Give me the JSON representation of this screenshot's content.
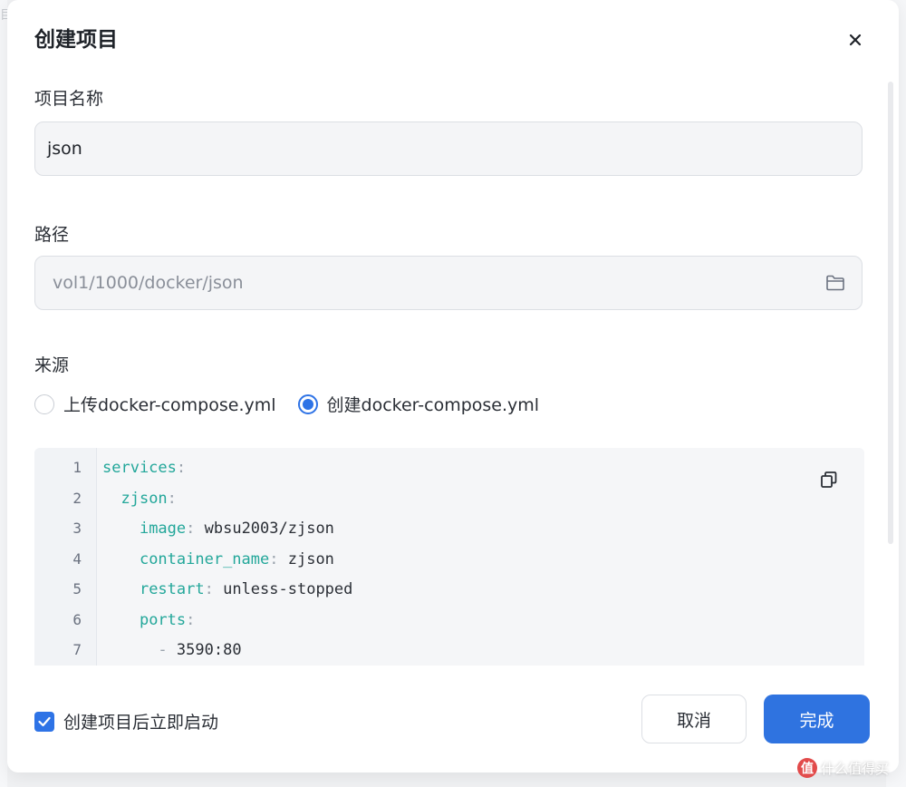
{
  "dialog": {
    "title": "创建项目",
    "close_label": "×"
  },
  "form": {
    "name_label": "项目名称",
    "name_value": "json",
    "path_label": "路径",
    "path_value": "vol1/1000/docker/json",
    "source_label": "来源",
    "source_options": [
      {
        "label": "上传docker-compose.yml",
        "selected": false
      },
      {
        "label": "创建docker-compose.yml",
        "selected": true
      }
    ]
  },
  "editor": {
    "lines": [
      {
        "num": "1",
        "indent": "",
        "key": "services",
        "sep": ":",
        "value": ""
      },
      {
        "num": "2",
        "indent": "  ",
        "key": "zjson",
        "sep": ":",
        "value": ""
      },
      {
        "num": "3",
        "indent": "    ",
        "key": "image",
        "sep": ": ",
        "value": "wbsu2003/zjson"
      },
      {
        "num": "4",
        "indent": "    ",
        "key": "container_name",
        "sep": ": ",
        "value": "zjson"
      },
      {
        "num": "5",
        "indent": "    ",
        "key": "restart",
        "sep": ": ",
        "value": "unless-stopped"
      },
      {
        "num": "6",
        "indent": "    ",
        "key": "ports",
        "sep": ":",
        "value": ""
      },
      {
        "num": "7",
        "indent": "      ",
        "key": "",
        "sep": "- ",
        "value": "3590:80"
      }
    ]
  },
  "footer": {
    "autostart_label": "创建项目后立即启动",
    "autostart_checked": true,
    "cancel_label": "取消",
    "done_label": "完成"
  },
  "watermark": {
    "logo": "值",
    "text": "什么值得买"
  },
  "colors": {
    "accent": "#2f73e0",
    "code_key": "#23a79a"
  },
  "icons": {
    "close": "close-icon",
    "folder": "folder-icon",
    "copy": "copy-icon",
    "check": "checkmark-icon"
  }
}
